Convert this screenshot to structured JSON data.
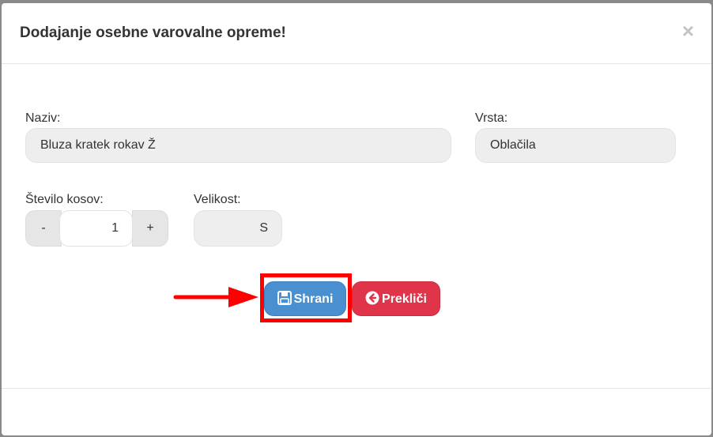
{
  "modal": {
    "title": "Dodajanje osebne varovalne opreme!",
    "close_icon": "close-icon",
    "close_glyph": "×"
  },
  "form": {
    "naziv": {
      "label": "Naziv:",
      "value": "Bluza kratek rokav Ž"
    },
    "vrsta": {
      "label": "Vrsta:",
      "value": "Oblačila"
    },
    "stevilo": {
      "label": "Število kosov:",
      "value": "1",
      "minus": "-",
      "plus": "+"
    },
    "velikost": {
      "label": "Velikost:",
      "value": "S"
    }
  },
  "actions": {
    "save_label": "Shrani",
    "save_icon": "floppy-disk-icon",
    "cancel_label": "Prekliči",
    "cancel_icon": "arrow-circle-left-icon"
  },
  "annotation": {
    "arrow_color": "#ff0000",
    "highlight_color": "#ff0000"
  }
}
